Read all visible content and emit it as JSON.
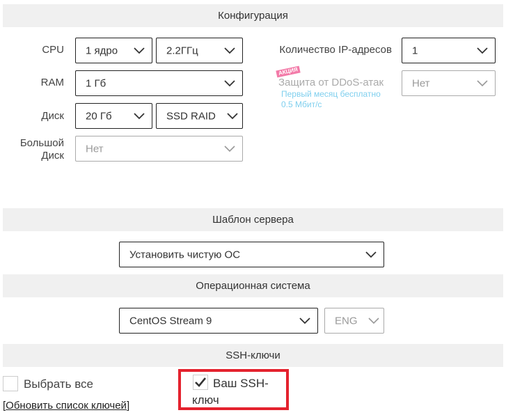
{
  "sections": {
    "config": "Конфигурация",
    "template": "Шаблон сервера",
    "os": "Операционная система",
    "ssh": "SSH-ключи"
  },
  "config": {
    "cpu": {
      "label": "CPU",
      "cores": "1 ядро",
      "freq": "2.2ГГц"
    },
    "ram": {
      "label": "RAM",
      "value": "1 Гб"
    },
    "disk": {
      "label": "Диск",
      "size": "20 Гб",
      "type": "SSD RAID"
    },
    "big_disk": {
      "label_line1": "Большой",
      "label_line2": "Диск",
      "value": "Нет"
    },
    "ip": {
      "label": "Количество IP-адресов",
      "value": "1"
    },
    "ddos": {
      "badge": "АКЦИЯ",
      "label": "Защита от DDoS-атак",
      "promo_line1": "Первый месяц бесплатно",
      "promo_line2": "0.5 Мбит/с",
      "value": "Нет"
    }
  },
  "template": {
    "value": "Установить чистую ОС"
  },
  "os": {
    "value": "CentOS Stream 9",
    "lang": "ENG"
  },
  "ssh": {
    "select_all": {
      "label": "Выбрать все",
      "checked": false
    },
    "key": {
      "label_line1": "Ваш SSH-",
      "label_line2": "ключ",
      "checked": true
    },
    "refresh_link": "Обновить список ключей",
    "highlight_color": "#e4222e"
  }
}
